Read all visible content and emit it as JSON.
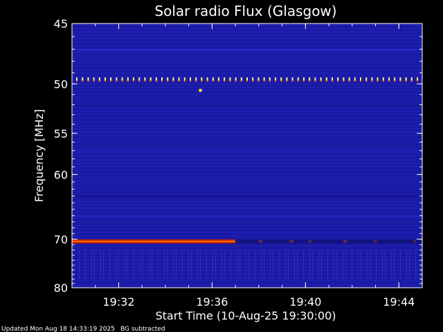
{
  "chart_data": {
    "type": "heatmap",
    "title": "Solar radio Flux (Glasgow)",
    "xlabel": "Start Time (10-Aug-25 19:30:00)",
    "ylabel": "Frequency [MHz]",
    "x_range_minutes": [
      "19:30",
      "19:45"
    ],
    "x_ticks": [
      "19:32",
      "19:36",
      "19:40",
      "19:44"
    ],
    "y_ticks": [
      "45",
      "50",
      "55",
      "60",
      "70",
      "80"
    ],
    "y_range_mhz": [
      45,
      80
    ],
    "background_color": "#1a1aa0",
    "features": [
      {
        "label": "dotted interference line",
        "frequency_mhz": 49.6,
        "start": "19:30",
        "end": "19:45",
        "color": "#ffff80"
      },
      {
        "label": "strong emission band",
        "frequency_mhz": 70.4,
        "start": "19:30",
        "end": "19:37",
        "color": "#ff6a00"
      },
      {
        "label": "bright dot",
        "frequency_mhz": 50.6,
        "start": "19:35:30",
        "end": "19:35:30",
        "color": "#ffff40"
      }
    ]
  },
  "footer": {
    "updated": "Updated Mon Aug 18 14:33:19 2025",
    "bg_note": "BG subtracted"
  }
}
